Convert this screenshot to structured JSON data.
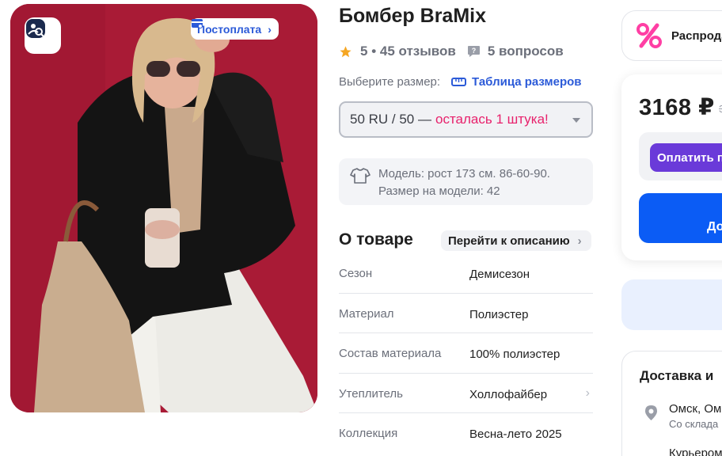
{
  "photo": {
    "postpay_label": "Постоплата"
  },
  "product": {
    "title": "Бомбер BraMix",
    "rating": "5",
    "reviews": "45 отзывов",
    "questions": "5 вопросов"
  },
  "size": {
    "label": "Выберите размер:",
    "table_link": "Таблица размеров",
    "selected": "50 RU / 50 —",
    "stock_note": "осталась 1 штука!"
  },
  "model": {
    "line1": "Модель: рост 173 см. 86-60-90.",
    "line2": "Размер на модели: 42"
  },
  "about": {
    "title": "О товаре",
    "goto_label": "Перейти к описанию",
    "specs": [
      {
        "key": "Сезон",
        "value": "Демисезон"
      },
      {
        "key": "Материал",
        "value": "Полиэстер"
      },
      {
        "key": "Состав материала",
        "value": "100% полиэстер"
      },
      {
        "key": "Утеплитель",
        "value": "Холлофайбер"
      },
      {
        "key": "Коллекция",
        "value": "Весна-лето 2025"
      }
    ]
  },
  "sidebar": {
    "sale_label": "Распродажа",
    "price": "3168 ₽",
    "old_price": "3",
    "pay_label": "Оплатить п",
    "add_label": "До",
    "delivery_title": "Доставка и",
    "city": "Омск, Ом",
    "warehouse": "Со склада",
    "courier": "Курьером"
  },
  "colors": {
    "accent_blue": "#0b5cf5",
    "link_blue": "#2b5ad8",
    "pay_purple": "#6a3ad9",
    "stock_pink": "#e8216c",
    "photo_bg": "#a91b36",
    "star": "#f5a623"
  },
  "icons": [
    "image-search-icon",
    "card-icon",
    "star-icon",
    "question-icon",
    "ruler-icon",
    "shirt-icon",
    "percent-icon",
    "location-pin-icon",
    "chevron-right-icon",
    "chevron-down-icon"
  ]
}
